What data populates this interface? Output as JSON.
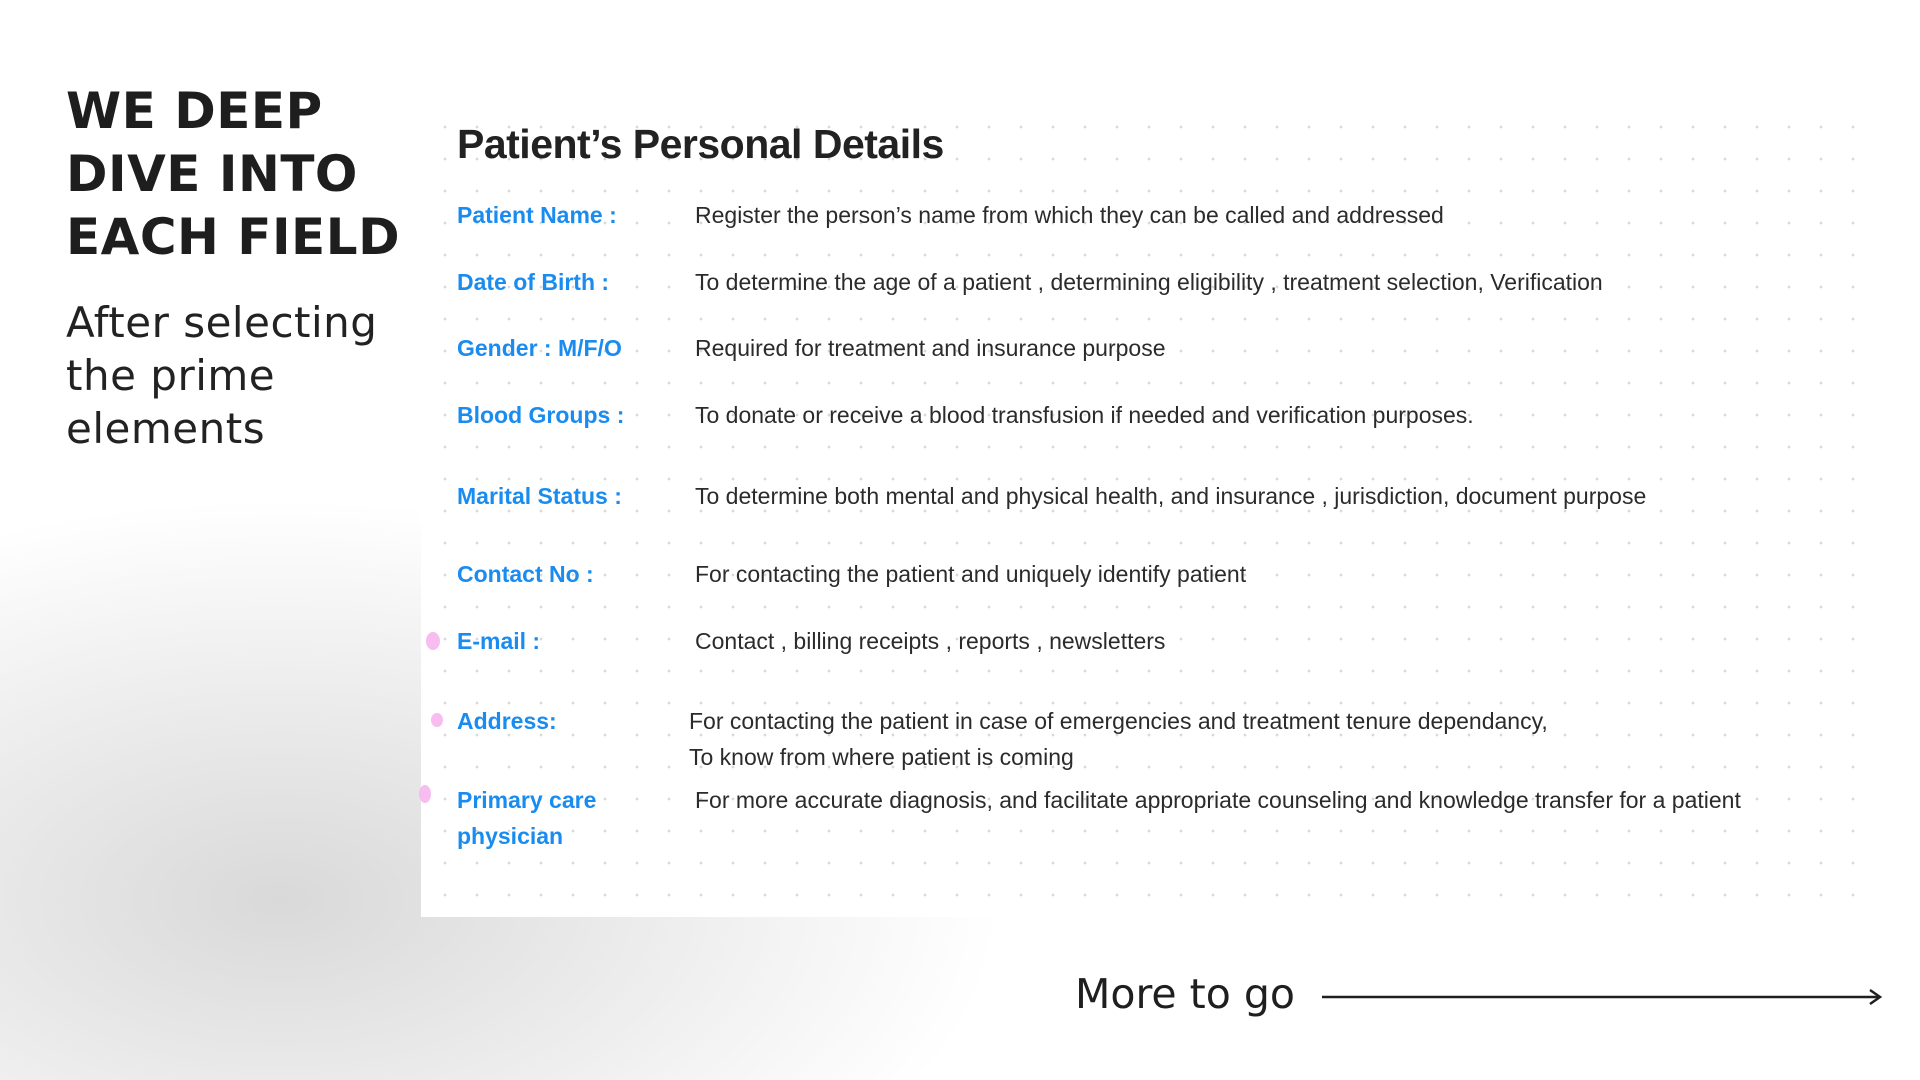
{
  "headline": {
    "lines": [
      "WE DEEP",
      "DIVE INTO",
      "EACH FIELD"
    ]
  },
  "subline": {
    "lines": [
      "After selecting",
      "the prime",
      "elements"
    ]
  },
  "card": {
    "title": "Patient’s Personal Details",
    "fields": [
      {
        "label": "Patient Name :",
        "description": "Register the person’s name from which they can be called and addressed"
      },
      {
        "label": "Date of Birth :",
        "description": "To determine the age of a patient , determining eligibility , treatment selection, Verification"
      },
      {
        "label": "Gender : M/F/O",
        "description": "Required for treatment and insurance purpose"
      },
      {
        "label": "Blood Groups :",
        "description": "To donate or receive a blood transfusion if needed and verification purposes."
      },
      {
        "label": "Marital Status :",
        "description": "To determine both mental and physical health, and insurance , jurisdiction, document purpose"
      },
      {
        "label": "Contact No :",
        "description": "For contacting the patient  and uniquely identify patient"
      },
      {
        "label": "E-mail :",
        "description": "Contact , billing receipts , reports , newsletters"
      },
      {
        "label": "Address:",
        "description_lines": [
          "For contacting the patient in case of emergencies and treatment tenure dependancy,",
          "To know from where patient is coming"
        ]
      },
      {
        "label_lines": [
          "Primary care",
          "physician"
        ],
        "description": "For more accurate diagnosis, and facilitate appropriate counseling and knowledge transfer for a patient"
      }
    ]
  },
  "footer": {
    "text": "More to go",
    "arrow_icon": "arrow-right-icon"
  },
  "colors": {
    "label_blue": "#1a8cf0",
    "marker_pink": "#f7b6ee",
    "text_dark": "#1e1e1e"
  }
}
